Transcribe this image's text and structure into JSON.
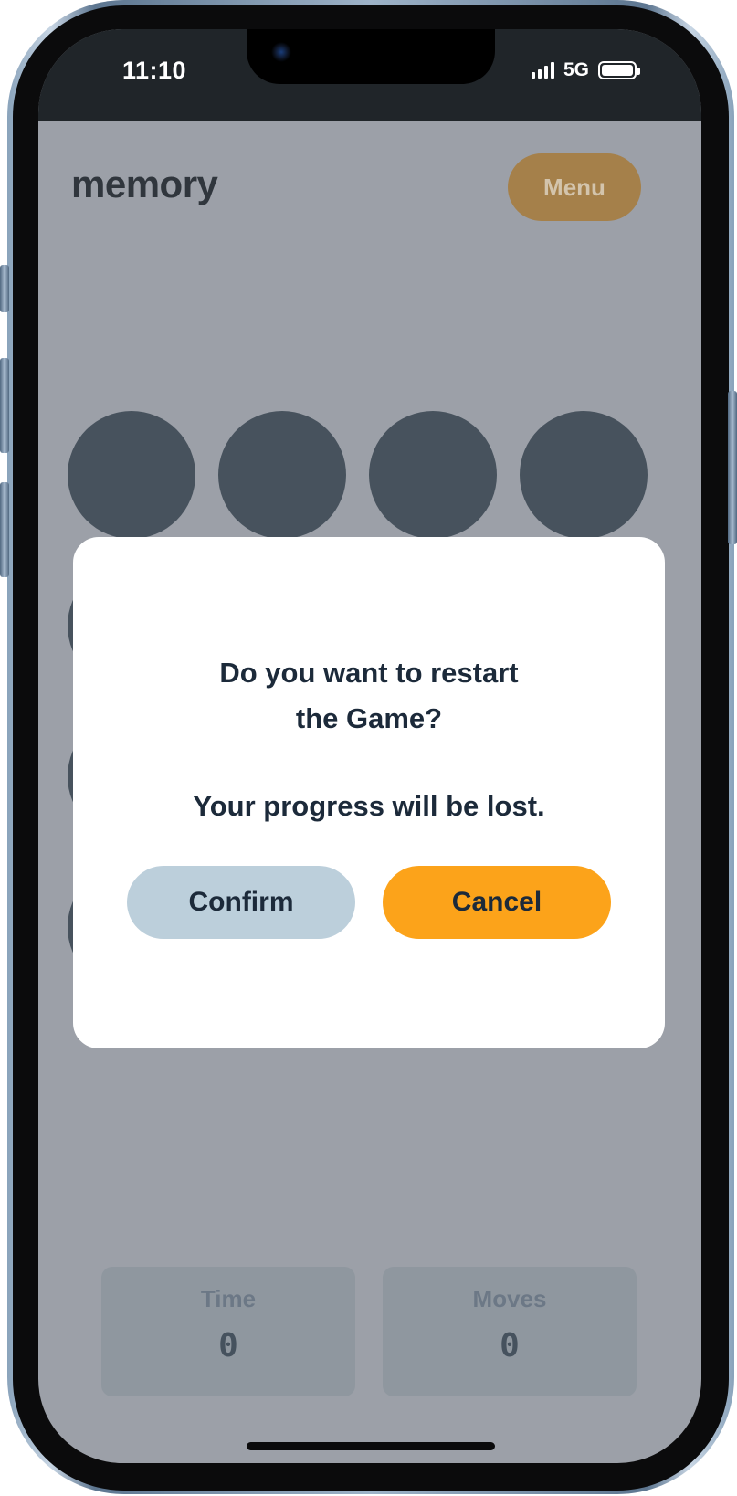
{
  "status_bar": {
    "time": "11:10",
    "network": "5G",
    "battery_level": 1.0,
    "signal_bars": 4
  },
  "header": {
    "title": "memory",
    "menu_label": "Menu"
  },
  "board": {
    "tiles_visible_rows": 4,
    "tiles_per_row": 4
  },
  "dialog": {
    "question_line1": "Do you want to restart",
    "question_line2": "the Game?",
    "warning": "Your progress will be lost.",
    "confirm_label": "Confirm",
    "cancel_label": "Cancel"
  },
  "stats": {
    "time_label": "Time",
    "time_value": "0",
    "moves_label": "Moves",
    "moves_value": "0"
  },
  "colors": {
    "accent": "#fca31a",
    "secondary_button": "#bccfdb",
    "text_dark": "#1c2a3a",
    "tile": "#47525d"
  }
}
